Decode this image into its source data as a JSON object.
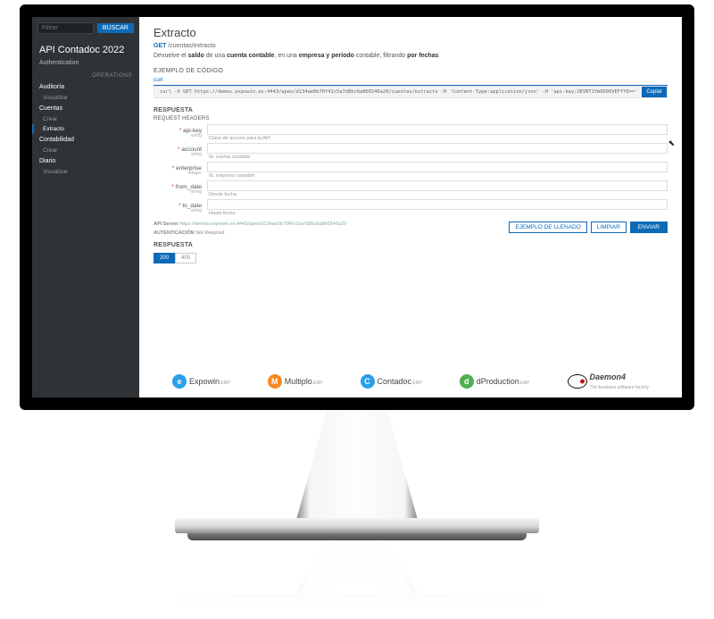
{
  "sidebar": {
    "filter_placeholder": "Filtrar",
    "search_btn": "BUSCAR",
    "api_title": "API Contadoc 2022",
    "authentication": "Authentication",
    "operations_heading": "OPERATIONS",
    "groups": [
      {
        "label": "Auditoría",
        "children": [
          {
            "label": "Visualizar"
          }
        ]
      },
      {
        "label": "Cuentas",
        "children": [
          {
            "label": "Crear"
          },
          {
            "label": "Extracto",
            "active": true
          }
        ]
      },
      {
        "label": "Contabilidad",
        "children": [
          {
            "label": "Crear"
          }
        ]
      },
      {
        "label": "Diario",
        "children": [
          {
            "label": "Visualizar"
          }
        ]
      }
    ]
  },
  "page": {
    "title": "Extracto",
    "method": "GET",
    "path": "/cuentas/extracto",
    "desc_pre": "Devuelve el ",
    "desc_b1": "saldo",
    "desc_mid1": " de una ",
    "desc_b2": "cuenta contable",
    "desc_mid2": ", en una ",
    "desc_b3": "empresa y período",
    "desc_mid3": " contable, filtrando ",
    "desc_b4": "por fechas"
  },
  "code": {
    "section": "EJEMPLO DE CÓDIGO",
    "tab": "curl",
    "cmd": "curl -X GET https://demos.expowin.es:4443/apex/d134ae0b70f41c5a7d8bc6a866546a29/cuentas/extracto -H 'Content-Type:application/json' -H 'api-key:XEVNT1YmQ09OVEFfYQ=='",
    "copy": "Copiar"
  },
  "resp": {
    "heading": "RESPUESTA",
    "req_headers": "REQUEST HEADERS",
    "params": [
      {
        "name": "api-key",
        "type": "string",
        "help": "Clave de acceso para la API"
      },
      {
        "name": "account",
        "type": "string",
        "help": "Id. cuenta contable"
      },
      {
        "name": "enterprise",
        "type": "integer",
        "help": "Id. empresa contable"
      },
      {
        "name": "from_date",
        "type": "string",
        "help": "Desde fecha"
      },
      {
        "name": "to_date",
        "type": "string",
        "help": "Hasta fecha"
      }
    ],
    "api_server_lbl": "API Server",
    "api_server_url": "https://demos.expowin.es:4443/apex/d134ae0b70f41c5a7d8bc6a866546a29",
    "auth_lbl": "AUTENTICACIÓN",
    "auth_val": "Not Required",
    "btn_example": "EJEMPLO DE LLENADO",
    "btn_clear": "LIMPIAR",
    "btn_send": "ENVIAR",
    "status_ok": "200",
    "status_err": "400"
  },
  "logos": {
    "expowin": "Expowin",
    "expowin_sub": ".ERP",
    "multiplo": "Multiplo",
    "multiplo_sub": ".ERP",
    "contadoc": "Contadoc",
    "contadoc_sub": ".ERP",
    "dprod": "dProduction",
    "dprod_sub": ".ERP",
    "daemon4": "Daemon4",
    "daemon4_sub": "The business software factory"
  }
}
